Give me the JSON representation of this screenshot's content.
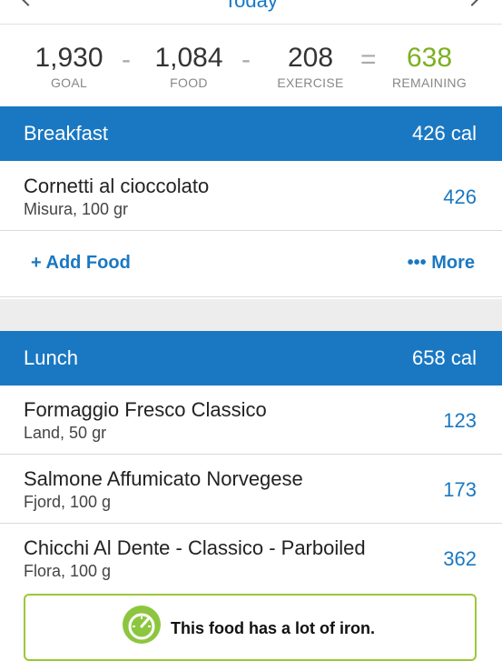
{
  "date_nav": {
    "title": "Today"
  },
  "summary": {
    "goal": {
      "value": "1,930",
      "label": "GOAL"
    },
    "food": {
      "value": "1,084",
      "label": "FOOD"
    },
    "exercise": {
      "value": "208",
      "label": "EXERCISE"
    },
    "remaining": {
      "value": "638",
      "label": "REMAINING"
    },
    "ops": {
      "minus": "-",
      "equals": "="
    }
  },
  "breakfast": {
    "name": "Breakfast",
    "calories": "426 cal",
    "items": [
      {
        "name": "Cornetti al cioccolato",
        "desc": "Misura, 100 gr",
        "cal": "426"
      }
    ],
    "add_label": "+ Add Food",
    "more_label": "••• More"
  },
  "lunch": {
    "name": "Lunch",
    "calories": "658 cal",
    "items": [
      {
        "name": "Formaggio Fresco Classico",
        "desc": "Land, 50 gr",
        "cal": "123"
      },
      {
        "name": "Salmone Affumicato Norvegese",
        "desc": "Fjord, 100 g",
        "cal": "173"
      },
      {
        "name": "Chicchi Al Dente - Classico - Parboiled",
        "desc": "Flora, 100 g",
        "cal": "362"
      }
    ]
  },
  "tip": {
    "text": "This food has a lot of iron.",
    "icon": "gauge-icon"
  },
  "colors": {
    "accent": "#1a78c2",
    "remaining": "#7cb020",
    "tip_border": "#9cc83a"
  }
}
